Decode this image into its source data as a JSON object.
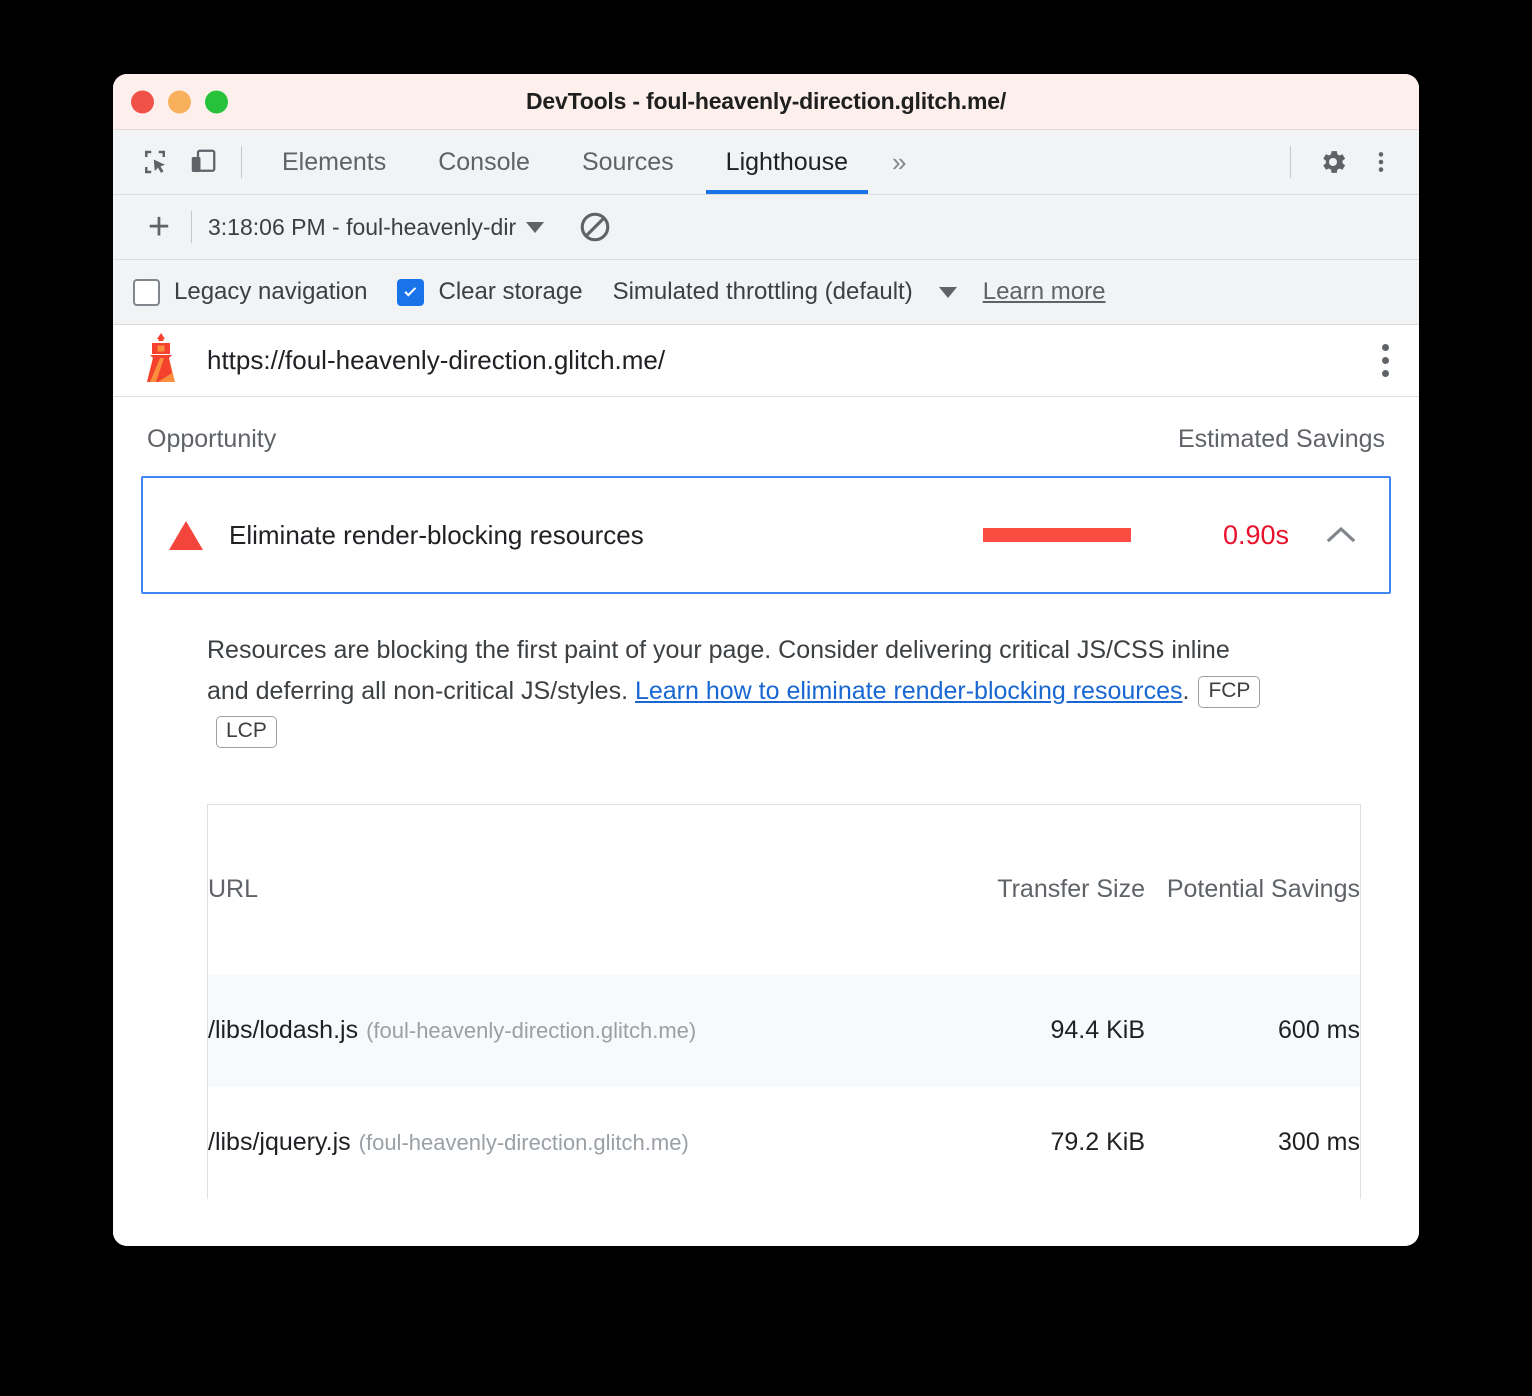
{
  "window": {
    "title": "DevTools - foul-heavenly-direction.glitch.me/",
    "traffic_lights": {
      "close_color": "#f0524a",
      "minimize_color": "#f9b05c",
      "maximize_color": "#27c23c"
    }
  },
  "tabbar": {
    "icons": [
      {
        "name": "inspect-element-icon"
      },
      {
        "name": "device-toolbar-icon"
      }
    ],
    "tabs": [
      {
        "label": "Elements",
        "active": false
      },
      {
        "label": "Console",
        "active": false
      },
      {
        "label": "Sources",
        "active": false
      },
      {
        "label": "Lighthouse",
        "active": true
      }
    ],
    "more_tabs_label": "»",
    "settings_icon": "gear-icon",
    "menu_icon": "kebab-menu-icon",
    "active_tab_color": "#1a73e8"
  },
  "lighthouse_toolbar": {
    "add_label": "+",
    "run_selected": "3:18:06 PM - foul-heavenly-dir",
    "clear_icon": "ban-icon"
  },
  "settings": {
    "legacy_navigation": {
      "label": "Legacy navigation",
      "checked": false
    },
    "clear_storage": {
      "label": "Clear storage",
      "checked": true
    },
    "throttling": {
      "label": "Simulated throttling (default)"
    },
    "learn_more": "Learn more",
    "accent_color": "#1a73e8"
  },
  "url_header": {
    "icon": "lighthouse-icon",
    "url": "https://foul-heavenly-direction.glitch.me/",
    "menu_icon": "kebab-menu-icon"
  },
  "report": {
    "columns": {
      "opportunity": "Opportunity",
      "estimated_savings": "Estimated Savings"
    },
    "audit": {
      "severity_icon": "warning-triangle-icon",
      "title": "Eliminate render-blocking resources",
      "savings_value": "0.90s",
      "savings_color": "#e8112b",
      "sparkbar_color": "#fb4c41",
      "expanded": true,
      "toggle_icon": "chevron-up-icon",
      "description_part1": "Resources are blocking the first paint of your page. Consider delivering critical JS/CSS inline and deferring all non-critical JS/styles. ",
      "description_link": "Learn how to eliminate render-blocking resources",
      "description_part2": ".",
      "metric_chips": [
        "FCP",
        "LCP"
      ]
    },
    "table": {
      "headers": {
        "url": "URL",
        "transfer_size": "Transfer Size",
        "potential_savings": "Potential Savings"
      },
      "rows": [
        {
          "path": "/libs/lodash.js",
          "host": "(foul-heavenly-direction.glitch.me)",
          "transfer_size": "94.4 KiB",
          "potential_savings": "600 ms"
        },
        {
          "path": "/libs/jquery.js",
          "host": "(foul-heavenly-direction.glitch.me)",
          "transfer_size": "79.2 KiB",
          "potential_savings": "300 ms"
        }
      ]
    }
  }
}
